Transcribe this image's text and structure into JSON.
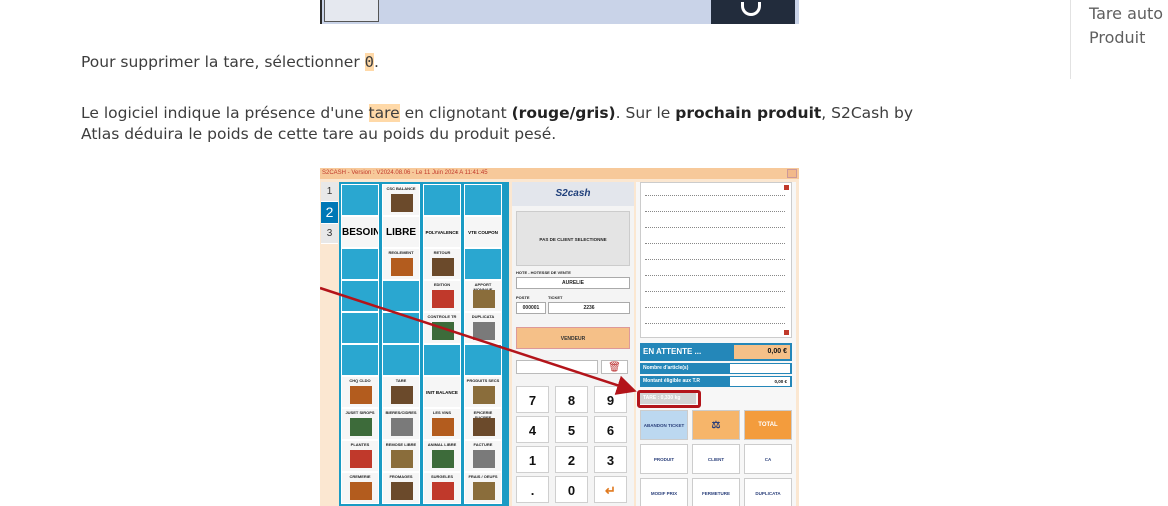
{
  "sidebar_toc": {
    "item_1": "Tare auto",
    "item_2": "Produit"
  },
  "paragraph_1": {
    "prefix": "Pour supprimer la tare, sélectionner ",
    "highlight": "0",
    "suffix": "."
  },
  "paragraph_2": {
    "t1": "Le logiciel indique la présence d'une ",
    "highlight": "tare",
    "t2": " en clignotant ",
    "bold1": "(rouge/gris)",
    "t3": ". Sur le ",
    "bold2": "prochain produit",
    "t4": ", S2Cash by",
    "line2": "Atlas déduira le poids de cette tare au poids du produit pesé."
  },
  "screenshot": {
    "titlebar": "S2CASH - Version : V2024.08.06 - Le 11 Juin 2024 A 11:41:45",
    "minimize": "_",
    "tabs": [
      "1",
      "2",
      "3"
    ],
    "grid_cells": [
      {
        "label": "CSC BALANCE",
        "type": "pic"
      },
      {
        "label": "BESOIN",
        "type": "big"
      },
      {
        "label": "LIBRE",
        "type": "big"
      },
      {
        "label": "POLYVALENCE",
        "type": "mid"
      },
      {
        "label": "VTE COUPON",
        "type": "mid"
      },
      {
        "label": "REGLEMENT",
        "type": "pic"
      },
      {
        "label": "RETOUR",
        "type": "pic"
      },
      {
        "label": "EDITION",
        "type": "pic"
      },
      {
        "label": "APPORT MONNAIE",
        "type": "pic"
      },
      {
        "label": "CONTROLE TR",
        "type": "pic"
      },
      {
        "label": "DUPLICATA",
        "type": "pic"
      },
      {
        "label": "CHQ CLDO",
        "type": "pic"
      },
      {
        "label": "TARE",
        "type": "pic"
      },
      {
        "label": "INIT BALANCE",
        "type": "mid"
      },
      {
        "label": "PRODUITS SECS",
        "type": "pic"
      },
      {
        "label": "JUSET SIROPS",
        "type": "pic"
      },
      {
        "label": "BIERES/CIDRES",
        "type": "pic"
      },
      {
        "label": "LES VINS",
        "type": "pic"
      },
      {
        "label": "EPICERIE SUCREE",
        "type": "pic"
      },
      {
        "label": "PLANTES",
        "type": "pic"
      },
      {
        "label": "REMOSE LIBRE",
        "type": "pic"
      },
      {
        "label": "ANIMAL LIBRE",
        "type": "pic"
      },
      {
        "label": "FACTURE",
        "type": "pic"
      },
      {
        "label": "CREMERIE",
        "type": "pic"
      },
      {
        "label": "FROMAGES",
        "type": "pic"
      },
      {
        "label": "SURGELES",
        "type": "pic"
      },
      {
        "label": "FRAIS / OEUFS",
        "type": "pic"
      }
    ],
    "logo": "S2cash",
    "client_box": "PAS DE CLIENT SELECTIONNE",
    "hote_label": "HOTE - HOTESSE DE VENTE",
    "hote_value": "AURELIE",
    "poste_label": "POSTE",
    "ticket_label": "TICKET",
    "poste_value": "000001",
    "ticket_value": "2236",
    "vendeur": "VENDEUR",
    "keys": [
      "7",
      "8",
      "9",
      "4",
      "5",
      "6",
      "1",
      "2",
      "3",
      ".",
      "0",
      "↵"
    ],
    "en_attente_label": "EN ATTENTE ...",
    "en_attente_value": "0,00 €",
    "nombre_label": "Nombre d'article(s)",
    "montant_label": "Montant éligible aux T.R",
    "montant_value": "0,00 €",
    "tare_label": "TARE : 0,330 kg",
    "buttons": {
      "abandon": "ABANDON TICKET",
      "total": "TOTAL",
      "produit": "PRODUIT",
      "client": "CLIENT",
      "ca": "CA",
      "modif_prix": "MODIF PRIX",
      "fermeture": "FERMETURE",
      "duplicata": "DUPLICATA"
    }
  }
}
